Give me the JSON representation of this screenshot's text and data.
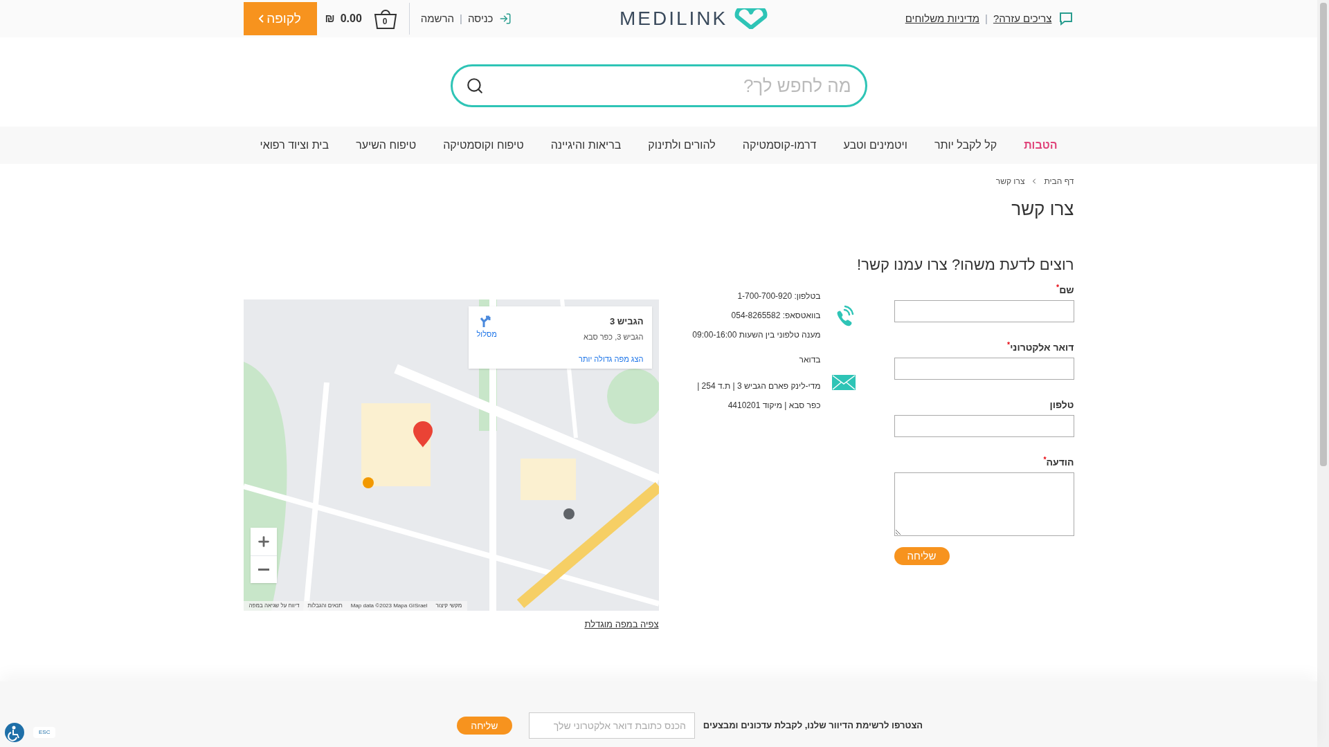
{
  "header": {
    "help_link": "צריכים עזרה?",
    "shipping_link": "מדיניות משלוחים",
    "logo": "MEDILINK",
    "login": "כניסה",
    "register": "הרשמה",
    "cart_count": "0",
    "cart_amount": "0.00",
    "cart_currency": "₪",
    "checkout": "לקופה",
    "separators": [
      "|",
      "|"
    ]
  },
  "search": {
    "placeholder": "מה לחפש לך?"
  },
  "nav": [
    {
      "label": "הטבות",
      "highlight": true
    },
    {
      "label": "קל לקבל יותר",
      "highlight": false
    },
    {
      "label": "ויטמינים וטבע",
      "highlight": false
    },
    {
      "label": "דרמו-קוסמטיקה",
      "highlight": false
    },
    {
      "label": "להורים ולתינוק",
      "highlight": false
    },
    {
      "label": "בריאות והיגיינה",
      "highlight": false
    },
    {
      "label": "טיפוח וקוסמטיקה",
      "highlight": false
    },
    {
      "label": "טיפוח השיער",
      "highlight": false
    },
    {
      "label": "בית וציוד רפואי",
      "highlight": false
    }
  ],
  "breadcrumb": [
    "דף הבית",
    "צרו קשר"
  ],
  "title": "צרו קשר",
  "form": {
    "title": "רוצים לדעת משהו? צרו עמנו קשר!",
    "fields": [
      {
        "label": "שם",
        "required": true,
        "kind": "input"
      },
      {
        "label": "דואר אלקטרוני",
        "required": true,
        "kind": "input"
      },
      {
        "label": "טלפון",
        "required": false,
        "kind": "input"
      },
      {
        "label": "הודעה",
        "required": true,
        "kind": "textarea"
      }
    ],
    "required_mark": "*",
    "submit": "שליחה"
  },
  "contact": [
    {
      "kind": "phone",
      "lines": [
        "בטלפון: 1-700-700-920",
        "בוואטסאפ: 054-8265582",
        "מענה טלפוני בין השעות 09:00-16:00"
      ]
    },
    {
      "kind": "mail",
      "lines": [
        "בדואר",
        "מדי-לינק פארם הגביש 3 | ת.ד 254 |",
        "כפר סבא | מיקוד 4410201"
      ]
    }
  ],
  "map": {
    "kind": "picture",
    "card_title": "הגביש 3",
    "card_address": "הגביש 3, כפר סבא",
    "card_link": "הצג מפה גדולה יותר",
    "directions": "מסלול",
    "attribution": [
      "מקשי קיצור",
      "Map data ©2023 Mapa GISrael",
      "תנאים והגבלות",
      "דיווח על שגיאה במפה"
    ],
    "large_map_link": "צפיה במפה מוגדלת"
  },
  "newsletter": {
    "text": "הצטרפו לרשימת הדיוור שלנו, לקבלת עדכונים ומבצעים",
    "placeholder": "הכנס כתובת דואר אלקטרוני שלך",
    "submit": "שליחה"
  },
  "accessibility": {
    "label": "ESC"
  }
}
